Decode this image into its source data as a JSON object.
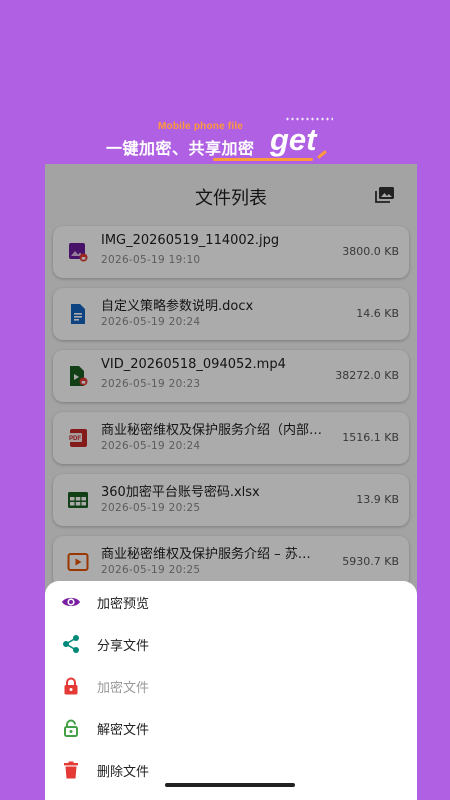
{
  "promo": {
    "subtitle": "Mobile phone file",
    "title": "一键加密、共享加密",
    "get_text": "get"
  },
  "app": {
    "title": "文件列表",
    "action_icon": "image-gallery-icon"
  },
  "files": [
    {
      "name": "IMG_20260519_114002.jpg",
      "date": "2026-05-19 19:10",
      "size": "3800.0 KB",
      "icon": "image-file-locked-icon",
      "color": "#6a1b9a"
    },
    {
      "name": "自定义策略参数说明.docx",
      "date": "2026-05-19 20:24",
      "size": "14.6 KB",
      "icon": "document-file-icon",
      "color": "#1565c0"
    },
    {
      "name": "VID_20260518_094052.mp4",
      "date": "2026-05-19 20:23",
      "size": "38272.0 KB",
      "icon": "video-file-locked-icon",
      "color": "#1b5e20"
    },
    {
      "name": "商业秘密维权及保护服务介绍（内部…",
      "date": "2026-05-19 20:24",
      "size": "1516.1 KB",
      "icon": "pdf-file-icon",
      "color": "#c62828"
    },
    {
      "name": "360加密平台账号密码.xlsx",
      "date": "2026-05-19 20:25",
      "size": "13.9 KB",
      "icon": "spreadsheet-file-icon",
      "color": "#1b5e20"
    },
    {
      "name": "商业秘密维权及保护服务介绍 – 苏…",
      "date": "2026-05-19 20:25",
      "size": "5930.7 KB",
      "icon": "presentation-file-icon",
      "color": "#e65100"
    }
  ],
  "sheet": {
    "items": [
      {
        "label": "加密预览",
        "icon": "eye-icon",
        "color": "#7b1fa2",
        "enabled": true
      },
      {
        "label": "分享文件",
        "icon": "share-icon",
        "color": "#00897b",
        "enabled": true
      },
      {
        "label": "加密文件",
        "icon": "lock-icon",
        "color": "#e53935",
        "enabled": false
      },
      {
        "label": "解密文件",
        "icon": "unlock-icon",
        "color": "#43a047",
        "enabled": true
      },
      {
        "label": "删除文件",
        "icon": "trash-icon",
        "color": "#e53935",
        "enabled": true
      }
    ]
  }
}
